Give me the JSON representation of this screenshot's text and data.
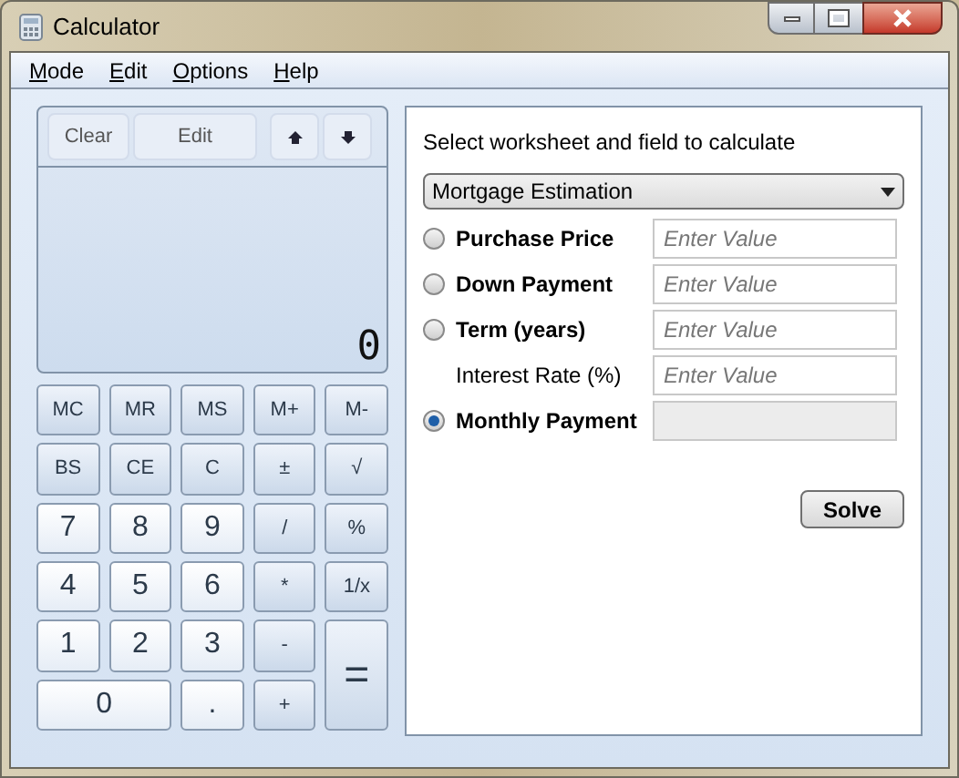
{
  "window": {
    "title": "Calculator"
  },
  "menu": [
    "Mode",
    "Edit",
    "Options",
    "Help"
  ],
  "history_bar": [
    {
      "label": "Clear",
      "kind": "text"
    },
    {
      "label": "Edit",
      "kind": "wide"
    },
    {
      "kind": "up"
    },
    {
      "kind": "down"
    }
  ],
  "display": {
    "value": "0"
  },
  "keys": [
    {
      "label": "MC",
      "kind": "op"
    },
    {
      "label": "MR",
      "kind": "op"
    },
    {
      "label": "MS",
      "kind": "op"
    },
    {
      "label": "M+",
      "kind": "op"
    },
    {
      "label": "M-",
      "kind": "op"
    },
    {
      "label": "BS",
      "kind": "op"
    },
    {
      "label": "CE",
      "kind": "op"
    },
    {
      "label": "C",
      "kind": "op"
    },
    {
      "label": "±",
      "kind": "op"
    },
    {
      "label": "√",
      "kind": "op"
    },
    {
      "label": "7",
      "kind": "digit"
    },
    {
      "label": "8",
      "kind": "digit"
    },
    {
      "label": "9",
      "kind": "digit"
    },
    {
      "label": "/",
      "kind": "op"
    },
    {
      "label": "%",
      "kind": "op"
    },
    {
      "label": "4",
      "kind": "digit"
    },
    {
      "label": "5",
      "kind": "digit"
    },
    {
      "label": "6",
      "kind": "digit"
    },
    {
      "label": "*",
      "kind": "op"
    },
    {
      "label": "1/x",
      "kind": "op"
    },
    {
      "label": "1",
      "kind": "digit"
    },
    {
      "label": "2",
      "kind": "digit"
    },
    {
      "label": "3",
      "kind": "digit"
    },
    {
      "label": "-",
      "kind": "op"
    },
    {
      "label": "=",
      "kind": "tall"
    },
    {
      "label": "0",
      "kind": "wide"
    },
    {
      "label": ".",
      "kind": "digit"
    },
    {
      "label": "+",
      "kind": "op"
    }
  ],
  "worksheet": {
    "prompt": "Select worksheet and field to calculate",
    "dropdown": "Mortgage Estimation",
    "fields": [
      {
        "label": "Purchase Price",
        "kind": "radio",
        "selected": false,
        "placeholder": "Enter Value",
        "disabled": false
      },
      {
        "label": "Down Payment",
        "kind": "radio",
        "selected": false,
        "placeholder": "Enter Value",
        "disabled": false
      },
      {
        "label": "Term (years)",
        "kind": "radio",
        "selected": false,
        "placeholder": "Enter Value",
        "disabled": false
      },
      {
        "label": "Interest Rate (%)",
        "kind": "plain",
        "placeholder": "Enter Value",
        "disabled": false
      },
      {
        "label": "Monthly Payment",
        "kind": "radio",
        "selected": true,
        "disabled": true
      }
    ],
    "solve_button": "Solve"
  }
}
